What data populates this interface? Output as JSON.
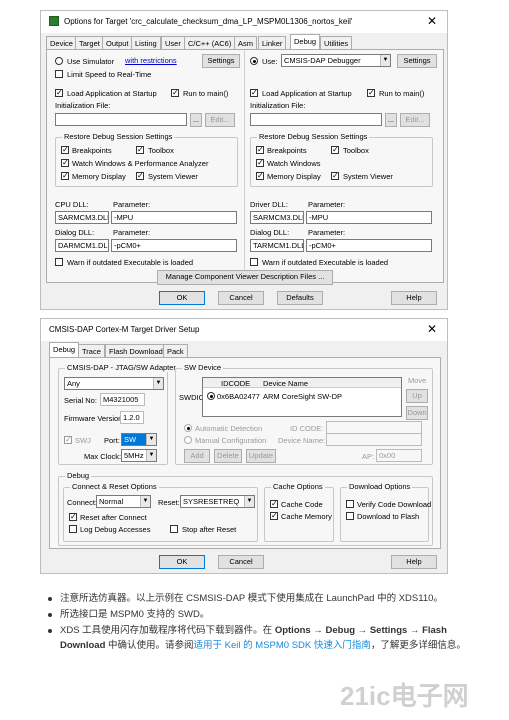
{
  "dialog1": {
    "title": "Options for Target 'crc_calculate_checksum_dma_LP_MSPM0L1306_nortos_keil'",
    "tabs": [
      "Device",
      "Target",
      "Output",
      "Listing",
      "User",
      "C/C++ (AC6)",
      "Asm",
      "Linker",
      "Debug",
      "Utilities"
    ],
    "active_tab": "Debug",
    "left": {
      "use_simulator": "Use Simulator",
      "with_restrictions": "with restrictions",
      "settings": "Settings",
      "limit_speed": "Limit Speed to Real-Time",
      "load_app": "Load Application at Startup",
      "run_to_main": "Run to main()",
      "init_file": "Initialization File:",
      "browse": "...",
      "edit": "Edit...",
      "restore_group": "Restore Debug Session Settings",
      "breakpoints": "Breakpoints",
      "toolbox": "Toolbox",
      "watch": "Watch Windows & Performance Analyzer",
      "memory": "Memory Display",
      "sysviewer": "System Viewer",
      "cpu_dll_label": "CPU DLL:",
      "param_label": "Parameter:",
      "cpu_dll": "SARMCM3.DLL",
      "cpu_param": "-MPU",
      "dialog_dll_label": "Dialog DLL:",
      "dialog_dll": "DARMCM1.DLL",
      "dialog_param": "-pCM0+",
      "warn": "Warn if outdated Executable is loaded"
    },
    "right": {
      "use": "Use:",
      "debugger": "CMSIS-DAP Debugger",
      "settings": "Settings",
      "load_app": "Load Application at Startup",
      "run_to_main": "Run to main()",
      "init_file": "Initialization File:",
      "browse": "...",
      "edit": "Edit...",
      "restore_group": "Restore Debug Session Settings",
      "breakpoints": "Breakpoints",
      "toolbox": "Toolbox",
      "watch": "Watch Windows",
      "memory": "Memory Display",
      "sysviewer": "System Viewer",
      "driver_dll_label": "Driver DLL:",
      "param_label": "Parameter:",
      "driver_dll": "SARMCM3.DLL",
      "driver_param": "-MPU",
      "dialog_dll_label": "Dialog DLL:",
      "dialog_dll": "TARMCM1.DLL",
      "dialog_param": "-pCM0+",
      "warn": "Warn if outdated Executable is loaded"
    },
    "manage_btn": "Manage Component Viewer Description Files ...",
    "ok": "OK",
    "cancel": "Cancel",
    "defaults": "Defaults",
    "help": "Help"
  },
  "dialog2": {
    "title": "CMSIS-DAP Cortex-M Target Driver Setup",
    "tabs": [
      "Debug",
      "Trace",
      "Flash Download",
      "Pack"
    ],
    "active_tab": "Debug",
    "adapter_group": "CMSIS-DAP - JTAG/SW Adapter",
    "adapter": "Any",
    "serial_label": "Serial No:",
    "serial": "M4321005",
    "fw_label": "Firmware Version:",
    "fw": "1.2.0",
    "swj": "SWJ",
    "port_label": "Port:",
    "port": "SW",
    "maxclock_label": "Max Clock:",
    "maxclock": "5MHz",
    "swdev_group": "SW Device",
    "col_idcode": "IDCODE",
    "col_devname": "Device Name",
    "swdio": "SWDIO",
    "row_idcode": "0x6BA02477",
    "row_name": "ARM CoreSight SW-DP",
    "move": "Move",
    "up": "Up",
    "down": "Down",
    "auto_detect": "Automatic Detection",
    "manual_config": "Manual Configuration",
    "id_code_label": "ID CODE:",
    "device_name_label": "Device Name:",
    "add": "Add",
    "delete": "Delete",
    "update": "Update",
    "ap_label": "AP:",
    "ap": "0x00",
    "debug_group": "Debug",
    "connect_group": "Connect & Reset Options",
    "connect_label": "Connect:",
    "connect": "Normal",
    "reset_label": "Reset:",
    "reset": "SYSRESETREQ",
    "reset_after": "Reset after Connect",
    "log_access": "Log Debug Accesses",
    "stop_after": "Stop after Reset",
    "cache_group": "Cache Options",
    "cache_code": "Cache Code",
    "cache_memory": "Cache Memory",
    "download_group": "Download Options",
    "verify": "Verify Code Download",
    "download_flash": "Download to Flash",
    "ok": "OK",
    "cancel": "Cancel",
    "help": "Help"
  },
  "notes": {
    "b1": "注意所选仿真器。以上示例在 CSMSIS-DAP 模式下使用集成在 LaunchPad 中的 XDS110。",
    "b2": "所选接口是 MSPM0 支持的 SWD。",
    "b3_pre": "XDS 工具使用闪存加载程序将代码下载到器件。在 ",
    "b3_bold1": "Options → Debug → Settings → Flash Download",
    "b3_mid": " 中确认使用。请参阅",
    "b3_link": "适用于 Keil 的 MSPM0 SDK 快速入门指南",
    "b3_post": "，了解更多详细信息。"
  },
  "watermark": "21ic电子网"
}
